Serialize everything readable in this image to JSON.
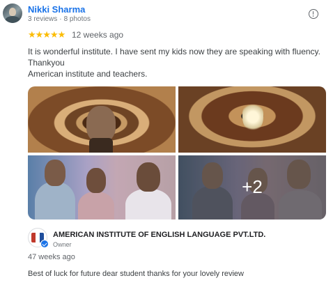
{
  "review": {
    "reviewer_name": "Nikki Sharma",
    "reviews_count": "3 reviews",
    "separator": "·",
    "photos_count": "8 photos",
    "rating": 5,
    "stars": "★★★★★",
    "time_ago": "12 weeks ago",
    "text_lines": [
      "It is wonderful institute. I have sent my kids now they are speaking with fluency.",
      "Thankyou",
      "American institute and teachers."
    ],
    "more_photos_label": "+2"
  },
  "owner_response": {
    "name": "AMERICAN INSTITUTE OF ENGLISH LANGUAGE PVT.LTD.",
    "role": "Owner",
    "time_ago": "47 weeks ago",
    "text": "Best of luck for future dear student thanks for your lovely review"
  },
  "colors": {
    "reviewer_link": "#1a73e8",
    "star": "#fbbc04",
    "verified": "#1a73e8"
  }
}
